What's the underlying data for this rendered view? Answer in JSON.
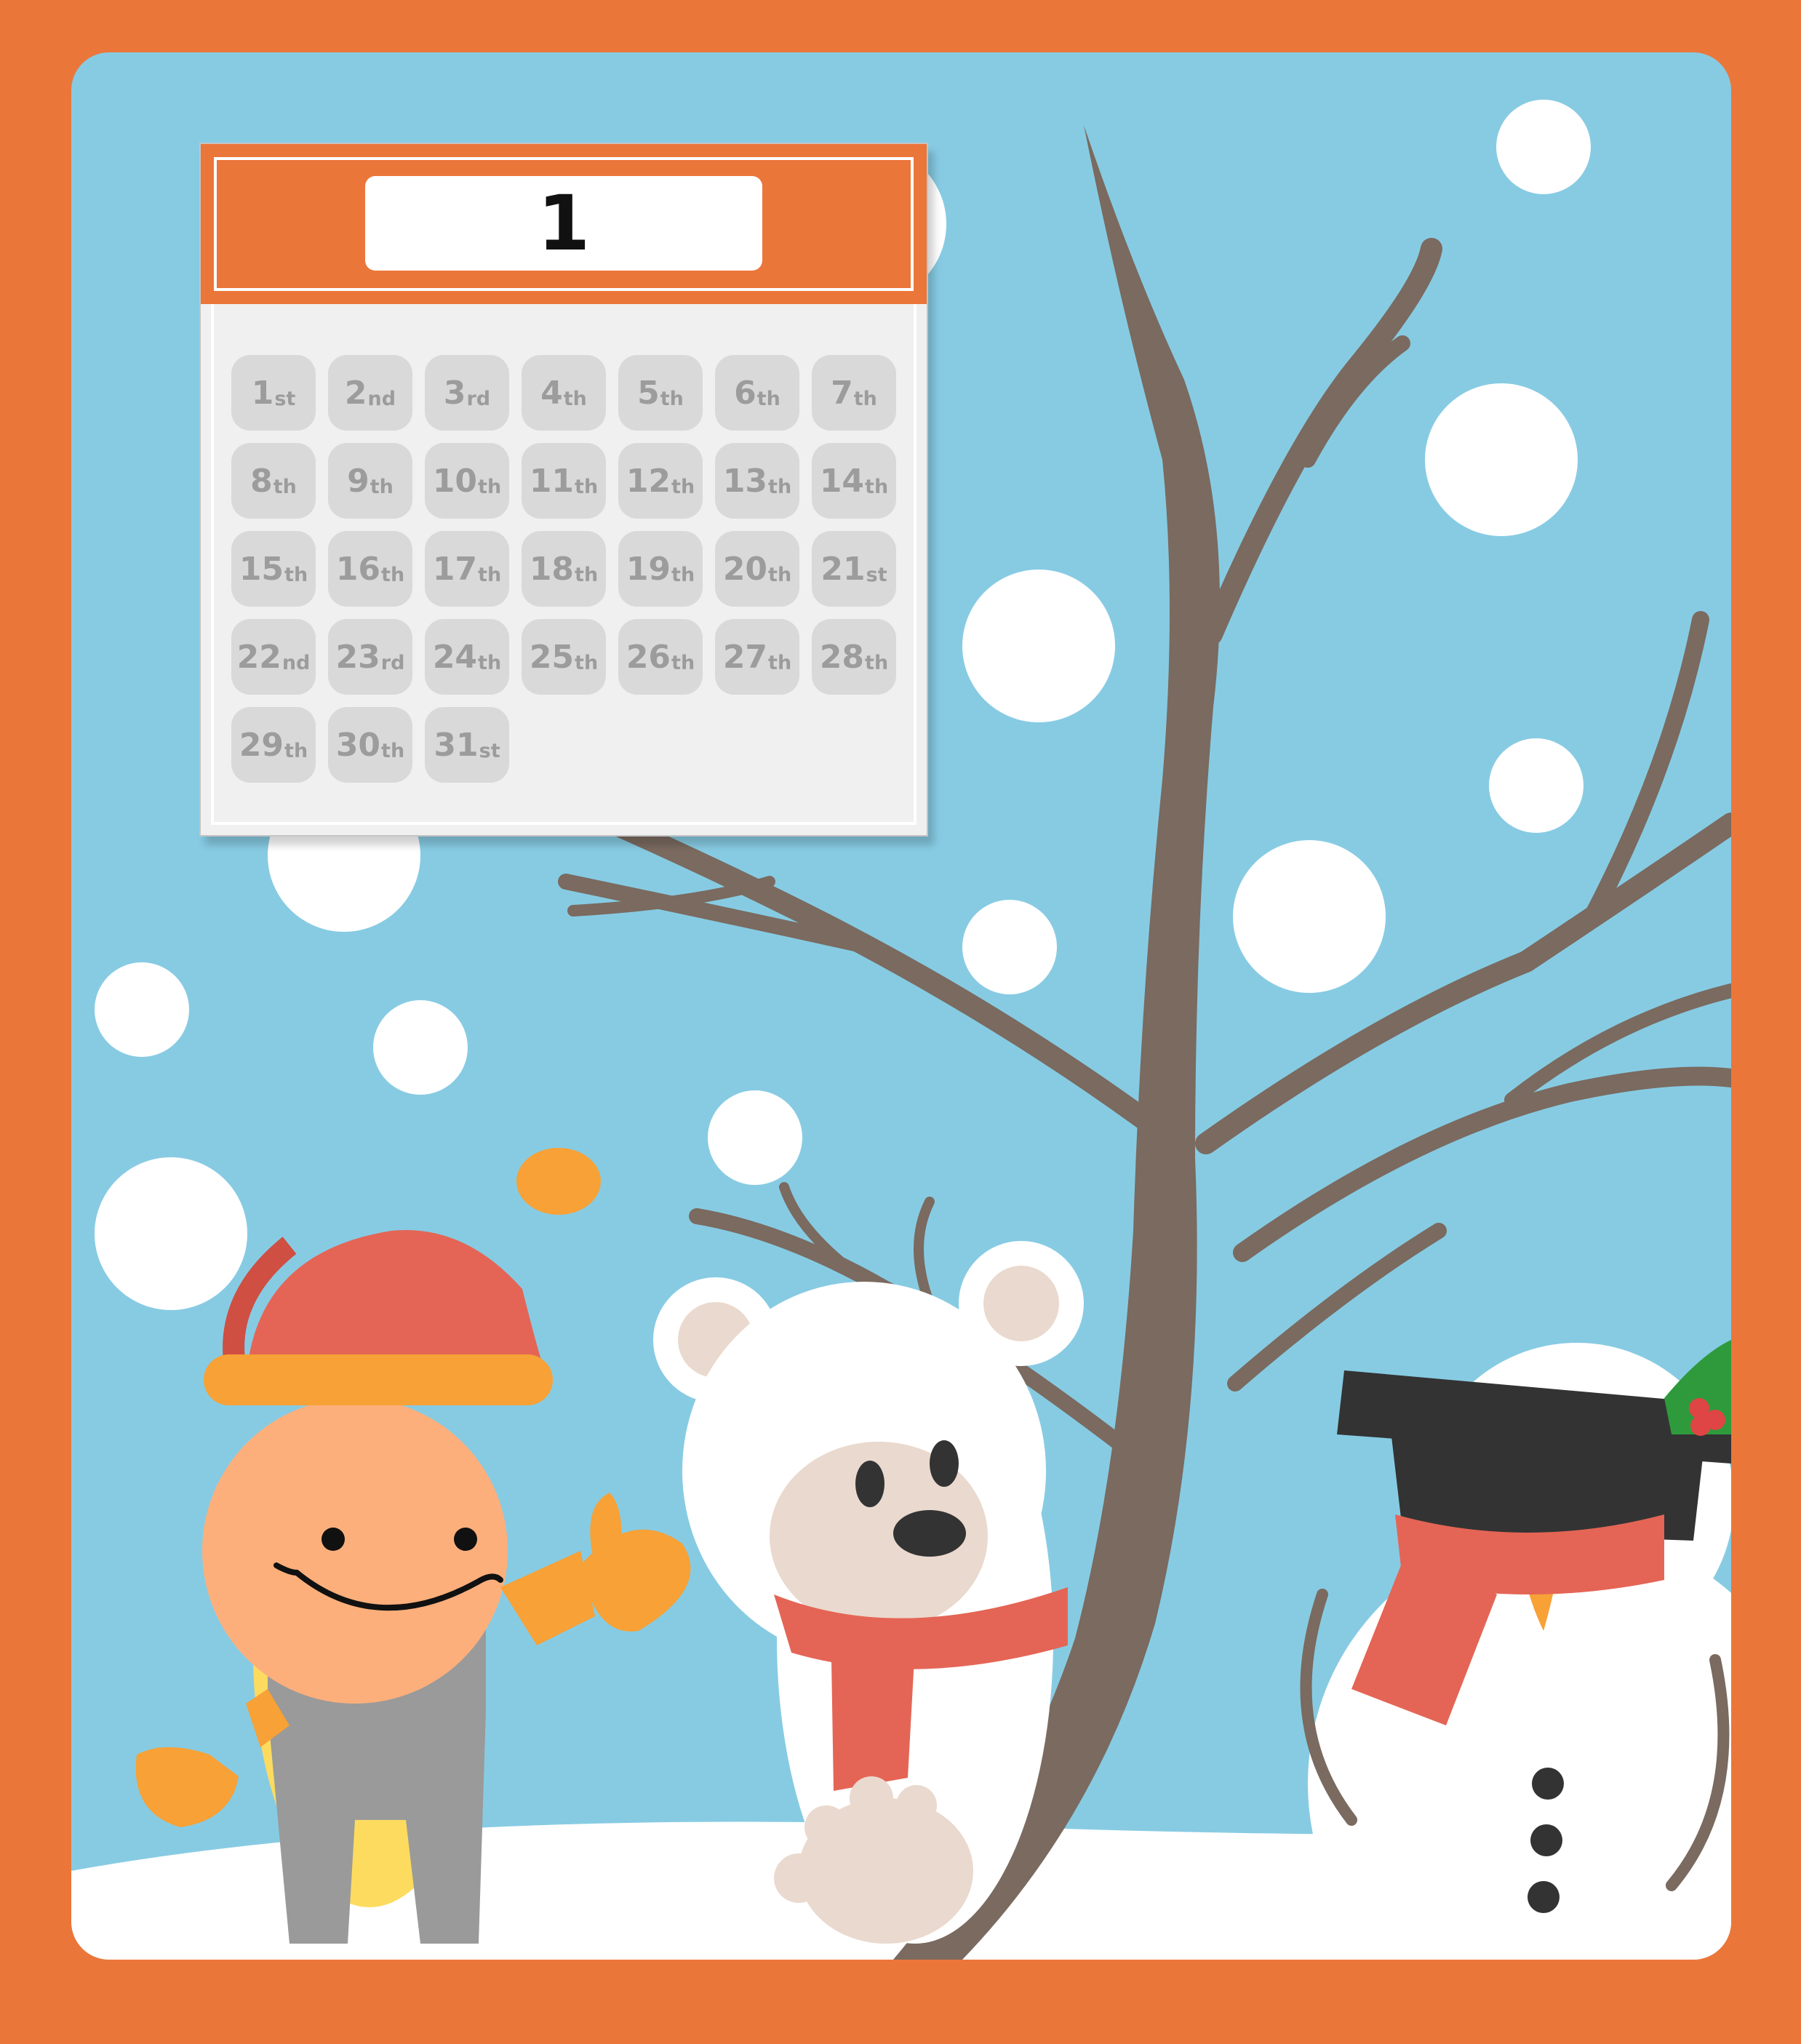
{
  "calendar": {
    "month": "1",
    "days": [
      {
        "num": "1",
        "suffix": "st"
      },
      {
        "num": "2",
        "suffix": "nd"
      },
      {
        "num": "3",
        "suffix": "rd"
      },
      {
        "num": "4",
        "suffix": "th"
      },
      {
        "num": "5",
        "suffix": "th"
      },
      {
        "num": "6",
        "suffix": "th"
      },
      {
        "num": "7",
        "suffix": "th"
      },
      {
        "num": "8",
        "suffix": "th"
      },
      {
        "num": "9",
        "suffix": "th"
      },
      {
        "num": "10",
        "suffix": "th"
      },
      {
        "num": "11",
        "suffix": "th"
      },
      {
        "num": "12",
        "suffix": "th"
      },
      {
        "num": "13",
        "suffix": "th"
      },
      {
        "num": "14",
        "suffix": "th"
      },
      {
        "num": "15",
        "suffix": "th"
      },
      {
        "num": "16",
        "suffix": "th"
      },
      {
        "num": "17",
        "suffix": "th"
      },
      {
        "num": "18",
        "suffix": "th"
      },
      {
        "num": "19",
        "suffix": "th"
      },
      {
        "num": "20",
        "suffix": "th"
      },
      {
        "num": "21",
        "suffix": "st"
      },
      {
        "num": "22",
        "suffix": "nd"
      },
      {
        "num": "23",
        "suffix": "rd"
      },
      {
        "num": "24",
        "suffix": "th"
      },
      {
        "num": "25",
        "suffix": "th"
      },
      {
        "num": "26",
        "suffix": "th"
      },
      {
        "num": "27",
        "suffix": "th"
      },
      {
        "num": "28",
        "suffix": "th"
      },
      {
        "num": "29",
        "suffix": "th"
      },
      {
        "num": "30",
        "suffix": "th"
      },
      {
        "num": "31",
        "suffix": "st"
      }
    ]
  },
  "colors": {
    "frame": "#EB763A",
    "sky": "#87CBE3",
    "snow": "#FFFFFF",
    "tree": "#7A6A5F",
    "day_tile": "#D9D9D9",
    "day_text": "#9C9C9C"
  },
  "illustration": {
    "elements": [
      "snowflake-dots",
      "bare-tree",
      "girl-in-santa-hat",
      "polar-bear",
      "snowman"
    ]
  }
}
